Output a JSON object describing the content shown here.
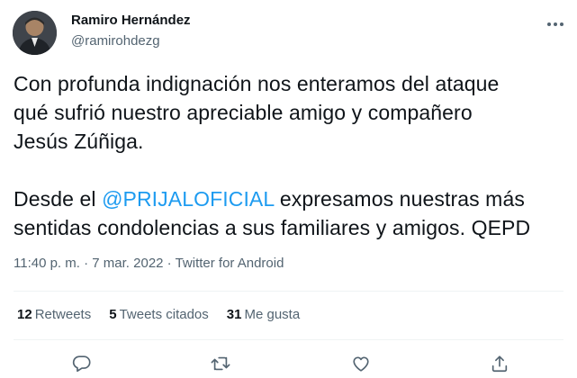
{
  "author": {
    "name": "Ramiro Hernández",
    "handle": "@ramirohdezg"
  },
  "tweet": {
    "line1": "Con profunda indignación nos enteramos del ataque",
    "line2": "qué sufrió nuestro apreciable amigo y compañero",
    "line3": "Jesús Zúñiga.",
    "p2_prefix": "Desde el ",
    "mention": "@PRIJALOFICIAL",
    "p2_suffix_1": " expresamos nuestras más",
    "p2_line2": "sentidas condolencias a sus familiares y amigos. QEPD"
  },
  "meta": {
    "time": "11:40 p. m.",
    "sep1": " · ",
    "date": "7 mar. 2022",
    "sep2": " · ",
    "source": "Twitter for Android"
  },
  "stats": {
    "retweets_count": "12",
    "retweets_label": "Retweets",
    "quotes_count": "5",
    "quotes_label": "Tweets citados",
    "likes_count": "31",
    "likes_label": "Me gusta"
  },
  "icons": {
    "more": "more-icon",
    "reply": "reply-icon",
    "retweet": "retweet-icon",
    "like": "heart-icon",
    "share": "share-icon"
  },
  "colors": {
    "text": "#0f1419",
    "secondary": "#536471",
    "accent": "#1d9bf0",
    "divider": "#eff3f4"
  }
}
